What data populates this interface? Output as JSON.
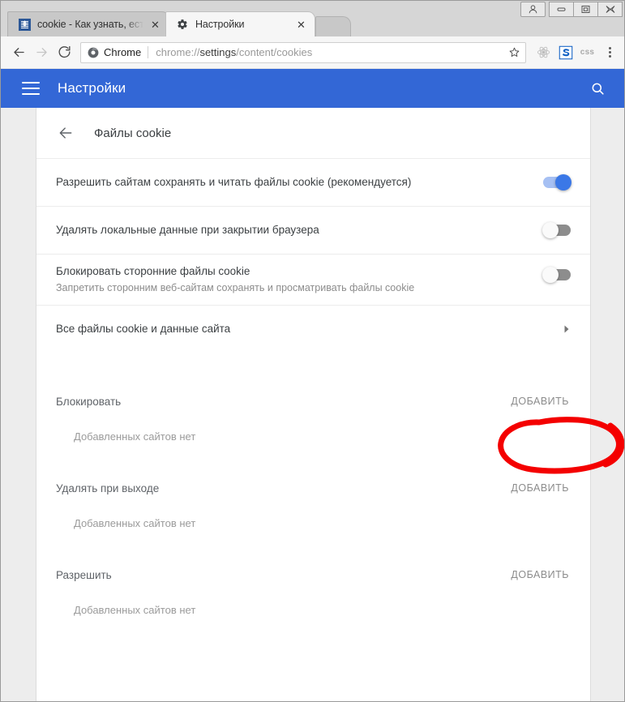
{
  "window": {
    "controls": [
      {
        "name": "profile-avatar",
        "glyph": "person"
      },
      {
        "name": "minimize",
        "glyph": "minimize"
      },
      {
        "name": "maximize",
        "glyph": "maximize"
      },
      {
        "name": "close",
        "glyph": "close"
      }
    ]
  },
  "tabs": [
    {
      "title": "cookie - Как узнать, есть",
      "favicon": "document-blue-icon",
      "active": false,
      "close_label": "✕"
    },
    {
      "title": "Настройки",
      "favicon": "gear-icon",
      "active": true,
      "close_label": "✕"
    }
  ],
  "new_tab_button_label": "",
  "toolbar": {
    "back_label": "←",
    "forward_label": "→",
    "reload_label": "⟳",
    "security_chip": "Chrome",
    "url_prefix": "chrome://",
    "url_bold": "settings",
    "url_suffix": "/content/cookies",
    "bookmark_label": "☆",
    "extensions": [
      {
        "name": "react-devtools-icon",
        "label": ""
      },
      {
        "name": "s-extension-icon",
        "label": "S"
      },
      {
        "name": "css-extension-icon",
        "label": "css"
      }
    ],
    "menu_label": "⋮"
  },
  "settings_header": {
    "menu_label": "☰",
    "title": "Настройки",
    "search_label": "search-icon"
  },
  "subpage": {
    "back_label": "←",
    "title": "Файлы cookie"
  },
  "toggle_rows": [
    {
      "primary": "Разрешить сайтам сохранять и читать файлы cookie (рекомендуется)",
      "secondary": "",
      "state": "on"
    },
    {
      "primary": "Удалять локальные данные при закрытии браузера",
      "secondary": "",
      "state": "off"
    },
    {
      "primary": "Блокировать сторонние файлы cookie",
      "secondary": "Запретить сторонним веб-сайтам сохранять и просматривать файлы cookie",
      "state": "off"
    }
  ],
  "link_row": {
    "label": "Все файлы cookie и данные сайта",
    "chevron": "chevron-right-icon"
  },
  "sections": [
    {
      "title": "Блокировать",
      "add_label": "ДОБАВИТЬ",
      "empty": "Добавленных сайтов нет",
      "annotated": true
    },
    {
      "title": "Удалять при выходе",
      "add_label": "ДОБАВИТЬ",
      "empty": "Добавленных сайтов нет",
      "annotated": false
    },
    {
      "title": "Разрешить",
      "add_label": "ДОБАВИТЬ",
      "empty": "Добавленных сайтов нет",
      "annotated": false
    }
  ],
  "annotation": {
    "name": "red-circle-highlight",
    "target": "ДОБАВИТЬ",
    "color": "#f40000"
  },
  "colors": {
    "settings_blue": "#3367d6",
    "toggle_on": "#3b78e7",
    "annotation_red": "#f40000",
    "chrome_frame": "#d6d6d6"
  }
}
